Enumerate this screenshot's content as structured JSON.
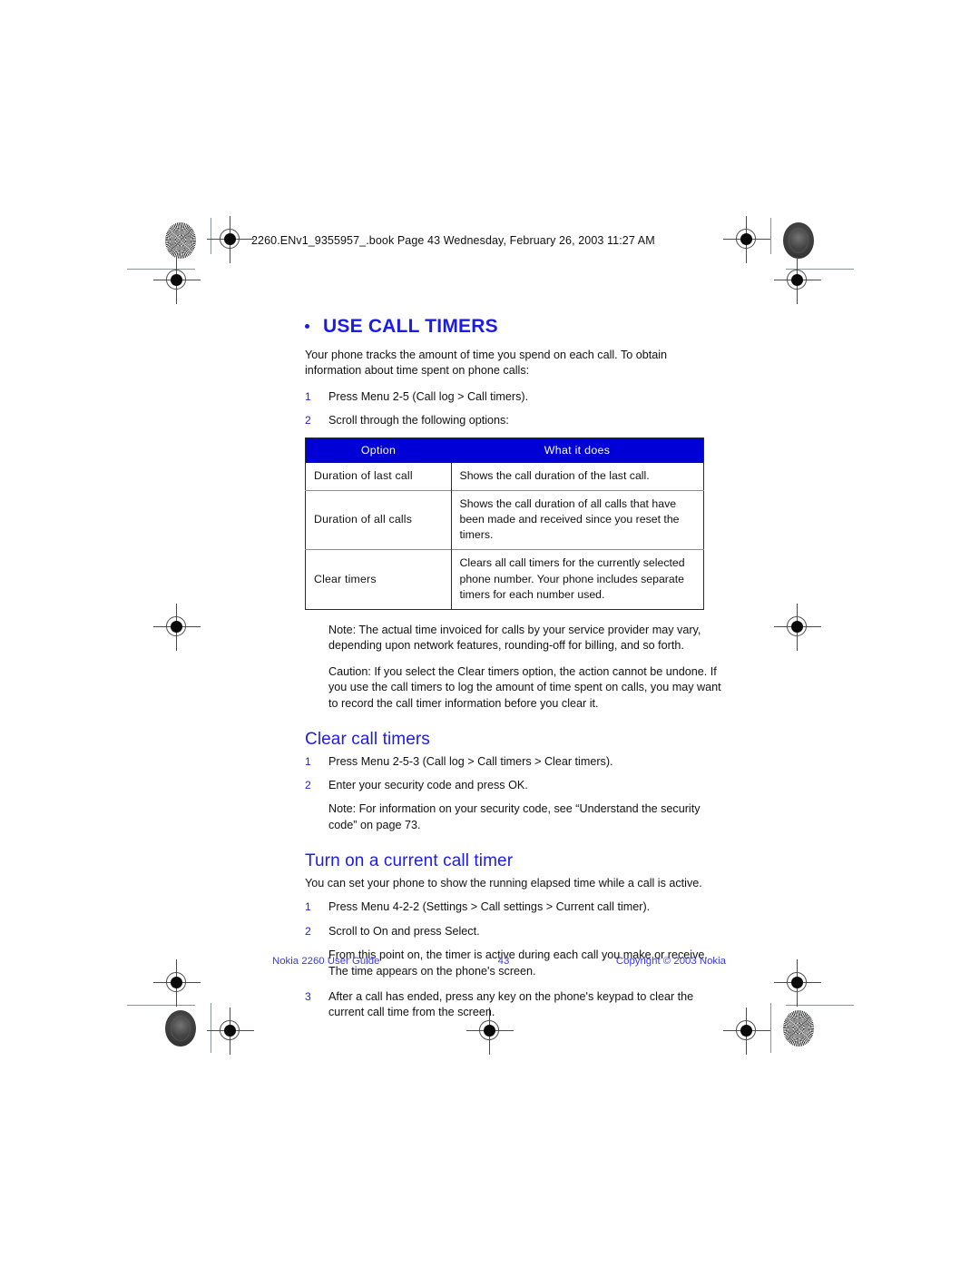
{
  "running_header": "2260.ENv1_9355957_.book  Page 43  Wednesday, February 26, 2003  11:27 AM",
  "chapter": {
    "title": "USE CALL TIMERS",
    "intro": "Your phone tracks the amount of time you spend on each call. To obtain information about time spent on phone calls:",
    "steps": [
      {
        "num": "1",
        "text": "Press Menu 2-5 (Call log > Call timers)."
      },
      {
        "num": "2",
        "text": "Scroll through the following options:"
      }
    ]
  },
  "options_table": {
    "headers": [
      "Option",
      "What it does"
    ],
    "rows": [
      {
        "option": "Duration of last call",
        "what_it_does": "Shows the call duration of the last call."
      },
      {
        "option": "Duration of all calls",
        "what_it_does": "Shows the call duration of all calls that have been made and received since you reset the timers."
      },
      {
        "option": "Clear timers",
        "what_it_does": "Clears all call timers for the currently selected phone number. Your phone includes separate timers for each number used."
      }
    ]
  },
  "notes": {
    "note_invoice": "Note: The actual time invoiced for calls by your service provider may vary, depending upon network features, rounding-off for billing, and so forth.",
    "caution_clear": "Caution: If you select the Clear timers option, the action cannot be undone. If you use the call timers to log the amount of time spent on calls, you may want to record the call timer information before you clear it."
  },
  "section_clear": {
    "title": "Clear call timers",
    "steps": [
      {
        "num": "1",
        "text": "Press Menu 2-5-3 (Call log > Call timers > Clear timers)."
      },
      {
        "num": "2",
        "text": "Enter your security code and press OK."
      }
    ],
    "note": "Note: For information on your security code, see “Understand the security code” on page 73."
  },
  "section_turnon": {
    "title": "Turn on a current call timer",
    "intro": "You can set your phone to show the running elapsed time while a call is active.",
    "steps": [
      {
        "num": "1",
        "text": "Press Menu 4-2-2 (Settings > Call settings > Current call timer)."
      },
      {
        "num": "2",
        "text": "Scroll to On and press Select."
      }
    ],
    "note": "From this point on, the timer is active during each call you make or receive. The time appears on the phone's screen.",
    "step3": {
      "num": "3",
      "text": "After a call has ended, press any key on the phone's keypad to clear the current call time from the screen."
    }
  },
  "footer": {
    "left": "Nokia 2260 User Guide",
    "page": "43",
    "right": "Copyright © 2003 Nokia"
  },
  "colors": {
    "heading_blue": "#1c1ce8",
    "table_header_blue": "#0000d6",
    "footer_blue": "#3a3ae0",
    "body_text": "#111111"
  }
}
